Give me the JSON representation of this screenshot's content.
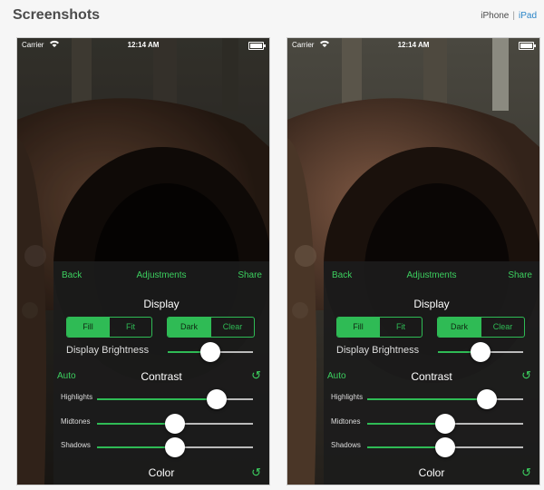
{
  "header": {
    "title": "Screenshots",
    "device_iphone": "iPhone",
    "device_ipad": "iPad",
    "separator": "|"
  },
  "screens": [
    {
      "status": {
        "carrier": "Carrier",
        "time": "12:14 AM"
      },
      "nav": {
        "back": "Back",
        "title": "Adjustments",
        "share": "Share"
      },
      "display": {
        "title": "Display",
        "fit_segment": [
          "Fill",
          "Fit"
        ],
        "fit_selected": "Fill",
        "theme_segment": [
          "Dark",
          "Clear"
        ],
        "theme_selected": "Dark",
        "brightness_label": "Display Brightness",
        "brightness": 0.5
      },
      "contrast": {
        "auto": "Auto",
        "title": "Contrast",
        "highlights_label": "Highlights",
        "highlights": 0.77,
        "midtones_label": "Midtones",
        "midtones": 0.5,
        "shadows_label": "Shadows",
        "shadows": 0.5
      },
      "color": {
        "title": "Color"
      }
    },
    {
      "status": {
        "carrier": "Carrier",
        "time": "12:14 AM"
      },
      "nav": {
        "back": "Back",
        "title": "Adjustments",
        "share": "Share"
      },
      "display": {
        "title": "Display",
        "fit_segment": [
          "Fill",
          "Fit"
        ],
        "fit_selected": "Fill",
        "theme_segment": [
          "Dark",
          "Clear"
        ],
        "theme_selected": "Dark",
        "brightness_label": "Display Brightness",
        "brightness": 0.5
      },
      "contrast": {
        "auto": "Auto",
        "title": "Contrast",
        "highlights_label": "Highlights",
        "highlights": 0.77,
        "midtones_label": "Midtones",
        "midtones": 0.5,
        "shadows_label": "Shadows",
        "shadows": 0.5
      },
      "color": {
        "title": "Color"
      }
    }
  ],
  "icons": {
    "wifi": "wifi-icon",
    "battery": "battery-icon",
    "reset": "reset-icon"
  },
  "colors": {
    "accent": "#2fbb55",
    "panel": "#1c1c1c",
    "link": "#2a84c7"
  }
}
